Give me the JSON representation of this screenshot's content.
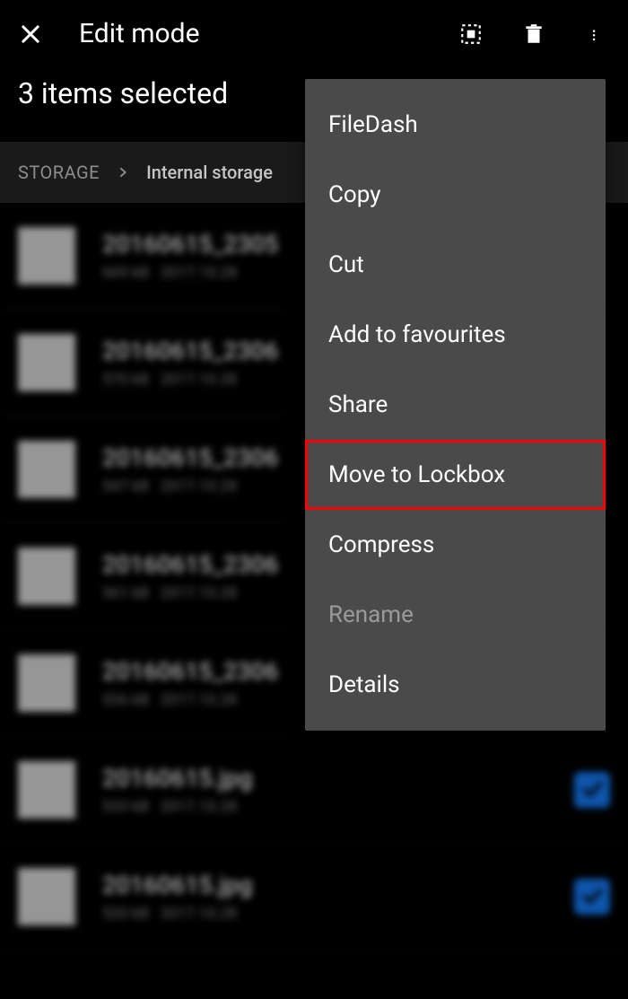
{
  "toolbar": {
    "title": "Edit mode"
  },
  "subtitle": "3 items selected",
  "breadcrumb": {
    "root": "STORAGE",
    "current": "Internal storage"
  },
  "menu": {
    "items": [
      {
        "label": "FileDash",
        "disabled": false,
        "highlight": false
      },
      {
        "label": "Copy",
        "disabled": false,
        "highlight": false
      },
      {
        "label": "Cut",
        "disabled": false,
        "highlight": false
      },
      {
        "label": "Add to favourites",
        "disabled": false,
        "highlight": false
      },
      {
        "label": "Share",
        "disabled": false,
        "highlight": false
      },
      {
        "label": "Move to Lockbox",
        "disabled": false,
        "highlight": true
      },
      {
        "label": "Compress",
        "disabled": false,
        "highlight": false
      },
      {
        "label": "Rename",
        "disabled": true,
        "highlight": false
      },
      {
        "label": "Details",
        "disabled": false,
        "highlight": false
      }
    ]
  },
  "files": [
    {
      "name": "20160615_2305",
      "size": "669 kB",
      "date": "2017.10.28",
      "checked": false
    },
    {
      "name": "20160615_2306",
      "size": "570 kB",
      "date": "2017.10.28",
      "checked": false
    },
    {
      "name": "20160615_2306",
      "size": "547 kB",
      "date": "2017.10.28",
      "checked": false
    },
    {
      "name": "20160615_2306",
      "size": "561 kB",
      "date": "2017.10.28",
      "checked": false
    },
    {
      "name": "20160615_2306",
      "size": "526 kB",
      "date": "2017.10.28",
      "checked": false
    },
    {
      "name": "20160615.jpg",
      "size": "533 kB",
      "date": "2017.10.28",
      "checked": true
    },
    {
      "name": "20160615.jpg",
      "size": "520 kB",
      "date": "2017.10.28",
      "checked": true
    }
  ]
}
